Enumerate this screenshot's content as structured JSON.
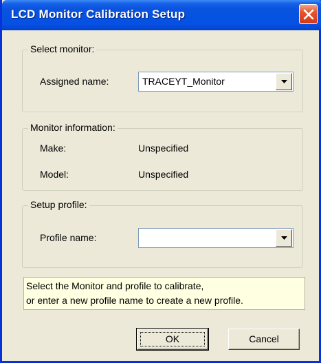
{
  "window": {
    "title": "LCD Monitor Calibration Setup",
    "title_bar_color": "#0553e0",
    "background": "#ece9d8"
  },
  "select_monitor": {
    "group_title": "Select monitor:",
    "assigned_name_label": "Assigned name:",
    "assigned_name_value": "TRACEYT_Monitor"
  },
  "monitor_info": {
    "group_title": "Monitor information:",
    "make_label": "Make:",
    "make_value": "Unspecified",
    "model_label": "Model:",
    "model_value": "Unspecified"
  },
  "setup_profile": {
    "group_title": "Setup profile:",
    "profile_name_label": "Profile name:",
    "profile_name_value": ""
  },
  "hint": {
    "line1": "Select the Monitor and profile to calibrate,",
    "line2": "or enter a new profile name to create a new profile.",
    "background": "#ffffe1"
  },
  "buttons": {
    "ok_label": "OK",
    "cancel_label": "Cancel"
  },
  "icons": {
    "close": "close-icon",
    "dropdown": "chevron-down-icon"
  }
}
